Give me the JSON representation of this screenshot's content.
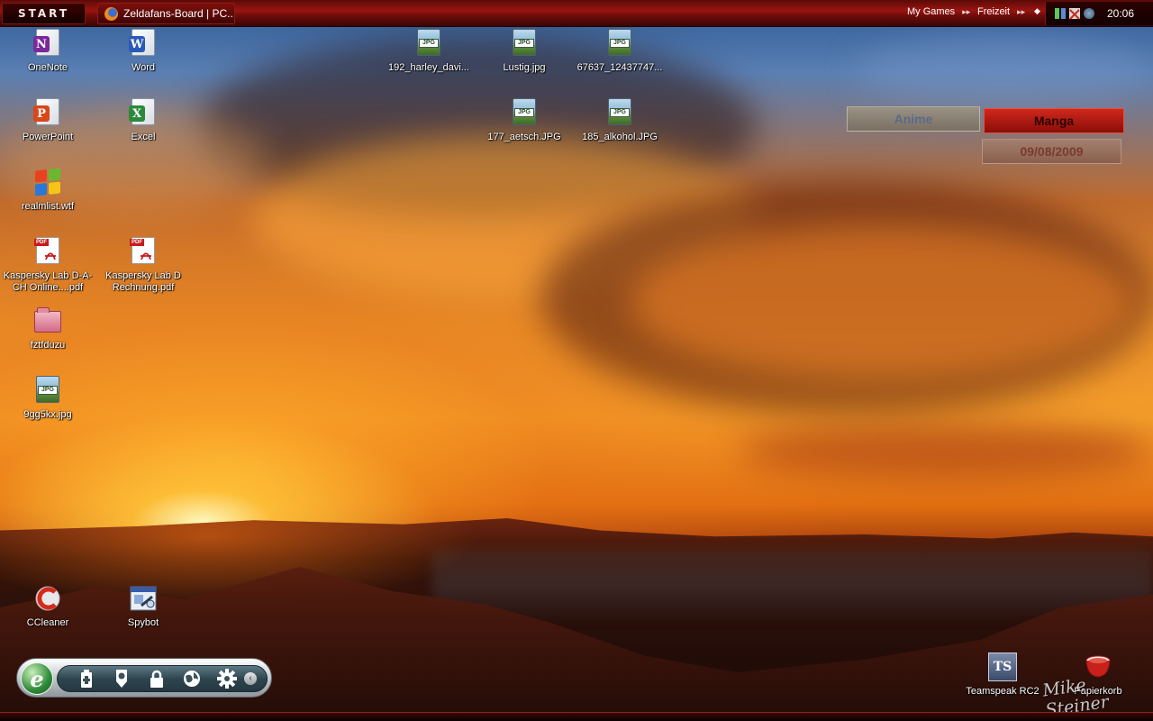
{
  "taskbar": {
    "start_label": "START",
    "task_title": "Zeldafans-Board | PC...",
    "quick_links": [
      {
        "label": "My Games"
      },
      {
        "label": "Freizeit"
      }
    ],
    "clock": "20:06"
  },
  "desktop": {
    "icons": [
      {
        "label": "OneNote"
      },
      {
        "label": "Word"
      },
      {
        "label": "192_harley_davi..."
      },
      {
        "label": "Lustig.jpg"
      },
      {
        "label": "67637_12437747..."
      },
      {
        "label": "PowerPoint"
      },
      {
        "label": "Excel"
      },
      {
        "label": "177_aetsch.JPG"
      },
      {
        "label": "185_alkohol.JPG"
      },
      {
        "label": "realmlist.wtf"
      },
      {
        "label": "Kaspersky Lab D-A-CH Online....pdf"
      },
      {
        "label": "Kaspersky Lab D Rechnung.pdf"
      },
      {
        "label": "fztfduzu"
      },
      {
        "label": "9gg5kx.jpg"
      },
      {
        "label": "CCleaner"
      },
      {
        "label": "Spybot"
      },
      {
        "label": "Teamspeak RC2"
      },
      {
        "label": "Papierkorb"
      }
    ],
    "jpg_tag": "JPG",
    "pdf_tag": "PDF",
    "ts_tag": "TS"
  },
  "widget": {
    "anime_label": "Anime",
    "manga_label": "Manga",
    "date": "09/08/2009"
  },
  "dock": {
    "logo_letter": "e"
  },
  "signature": "Mike Steiner",
  "colors": {
    "taskbar": "#9a1410",
    "widget_active": "#d0281c",
    "dock_bar": "#2e4650"
  }
}
